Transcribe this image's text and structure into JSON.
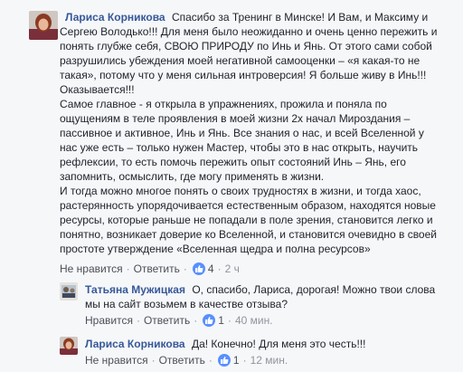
{
  "comments": [
    {
      "author": "Лариса Корникова",
      "lines": [
        "Спасибо за Тренинг в Минске! И Вам, и Максиму и",
        "Сергею Володько!!! Для меня было неожиданно и очень ценно пережить и",
        "понять глубже себя, СВОЮ ПРИРОДУ по Инь и Янь. От этого сами собой",
        "разрушились убеждения моей негативной самооценки – «я какая-то не",
        "такая», потому что у меня сильная интроверсия! Я больше живу в Инь!!!",
        "Оказывается!!!",
        "Самое главное - я открыла в упражнениях, прожила и поняла по",
        "ощущениям в теле проявления в моей жизни 2х начал Мироздания –",
        "пассивное и активное, Инь и Янь. Все знания о нас, и всей Вселенной у",
        "нас уже есть – только нужен Мастер, чтобы это в нас открыть, научить",
        "рефлексии, то есть помочь пережить опыт состояний Инь – Янь, его",
        "запомнить, осмыслить, где могу применять в жизни.",
        "И тогда можно многое понять о своих трудностях в жизни, и тогда хаос,",
        "растерянность упорядочивается естественным образом, находятся новые",
        "ресурсы, которые раньше не попадали в поле зрения, становится легко и",
        "понятно, возникает доверие ко Вселенной, и становится очевидно в своей",
        "простоте утверждение «Вселенная щедра и полна ресурсов»"
      ],
      "actions": {
        "like": "Не нравится",
        "reply": "Ответить",
        "count": "4",
        "time": "2 ч"
      }
    },
    {
      "author": "Татьяна Мужицкая",
      "lines": [
        "О, спасибо, Лариса, дорогая! Можно твои слова",
        "мы на сайт возьмем в качестве отзыва?"
      ],
      "actions": {
        "like": "Нравится",
        "reply": "Ответить",
        "count": "1",
        "time": "40 мин."
      }
    },
    {
      "author": "Лариса Корникова",
      "lines": [
        "Да! Конечно! Для меня это честь!!!"
      ],
      "actions": {
        "like": "Не нравится",
        "reply": "Ответить",
        "count": "1",
        "time": "12 мин."
      }
    }
  ],
  "colors": {
    "author": "#365899",
    "like_badge": "#5890ff",
    "background": "#f6f7f9"
  }
}
